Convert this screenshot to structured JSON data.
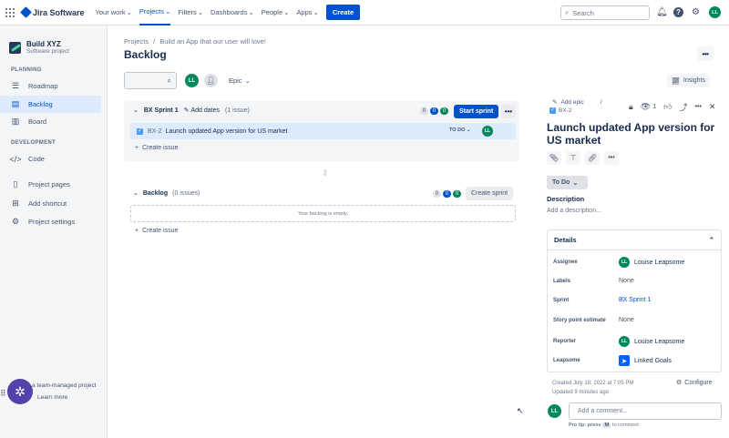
{
  "topnav": {
    "app_name": "Jira Software",
    "items": [
      "Your work",
      "Projects",
      "Filters",
      "Dashboards",
      "People",
      "Apps"
    ],
    "active_item": "Projects",
    "create_label": "Create",
    "search_placeholder": "Search",
    "user_initials": "LL"
  },
  "sidebar": {
    "project_name": "Build XYZ",
    "project_type": "Software project",
    "planning_label": "PLANNING",
    "planning_items": [
      {
        "label": "Roadmap",
        "icon": "roadmap-icon"
      },
      {
        "label": "Backlog",
        "icon": "backlog-icon"
      },
      {
        "label": "Board",
        "icon": "board-icon"
      }
    ],
    "active_item": "Backlog",
    "development_label": "DEVELOPMENT",
    "development_items": [
      {
        "label": "Code",
        "icon": "code-icon"
      }
    ],
    "other_items": [
      {
        "label": "Project pages",
        "icon": "pages-icon"
      },
      {
        "label": "Add shortcut",
        "icon": "add-shortcut-icon"
      },
      {
        "label": "Project settings",
        "icon": "settings-icon"
      }
    ],
    "footer_text": "a team-managed project",
    "footer_link": "Learn more"
  },
  "main": {
    "breadcrumb": [
      "Projects",
      "/",
      "Build an App that our user will love!"
    ],
    "title": "Backlog",
    "filter_avatar_initials": "LL",
    "epic_label": "Epic",
    "insights_label": "Insights"
  },
  "sprint": {
    "name": "BX Sprint 1",
    "add_dates_label": "Add dates",
    "issue_count_label": "(1 issue)",
    "badges": [
      "0",
      "0",
      "0"
    ],
    "start_label": "Start sprint",
    "issue": {
      "key": "BX-2",
      "summary": "Launch updated App version for US market",
      "status": "TO DO",
      "assignee_initials": "LL"
    },
    "create_issue_label": "Create issue"
  },
  "backlog": {
    "name": "Backlog",
    "issue_count_label": "(0 issues)",
    "badges": [
      "0",
      "0",
      "0"
    ],
    "create_sprint_label": "Create sprint",
    "empty_text": "Your backlog is empty.",
    "create_issue_label": "Create issue"
  },
  "detail": {
    "add_epic_label": "Add epic",
    "slash": "/",
    "issue_key": "BX-2",
    "watch_count": "1",
    "title": "Launch updated App version for US market",
    "status_label": "To Do",
    "description_label": "Description",
    "description_placeholder": "Add a description...",
    "details_label": "Details",
    "fields": [
      {
        "label": "Assignee",
        "value": "Louise Leapsome",
        "kind": "avatar"
      },
      {
        "label": "Labels",
        "value": "None",
        "kind": "muted"
      },
      {
        "label": "Sprint",
        "value": "BX Sprint 1",
        "kind": "link"
      },
      {
        "label": "Story point estimate",
        "value": "None",
        "kind": "muted"
      },
      {
        "label": "Reporter",
        "value": "Louise Leapsome",
        "kind": "avatar"
      },
      {
        "label": "Leapsome",
        "value": "Linked Goals",
        "kind": "app"
      }
    ],
    "created_text": "Created July 18, 2022 at 7:05 PM",
    "updated_text": "Updated 9 minutes ago",
    "configure_label": "Configure",
    "comment_avatar_initials": "LL",
    "comment_placeholder": "Add a comment...",
    "protip_prefix": "Pro tip: press",
    "protip_key": "M",
    "protip_suffix": "to comment"
  },
  "colors": {
    "brand": "#0052cc",
    "avatar": "#00875a",
    "selected_row": "#deebff",
    "help_fab": "#5243aa"
  }
}
